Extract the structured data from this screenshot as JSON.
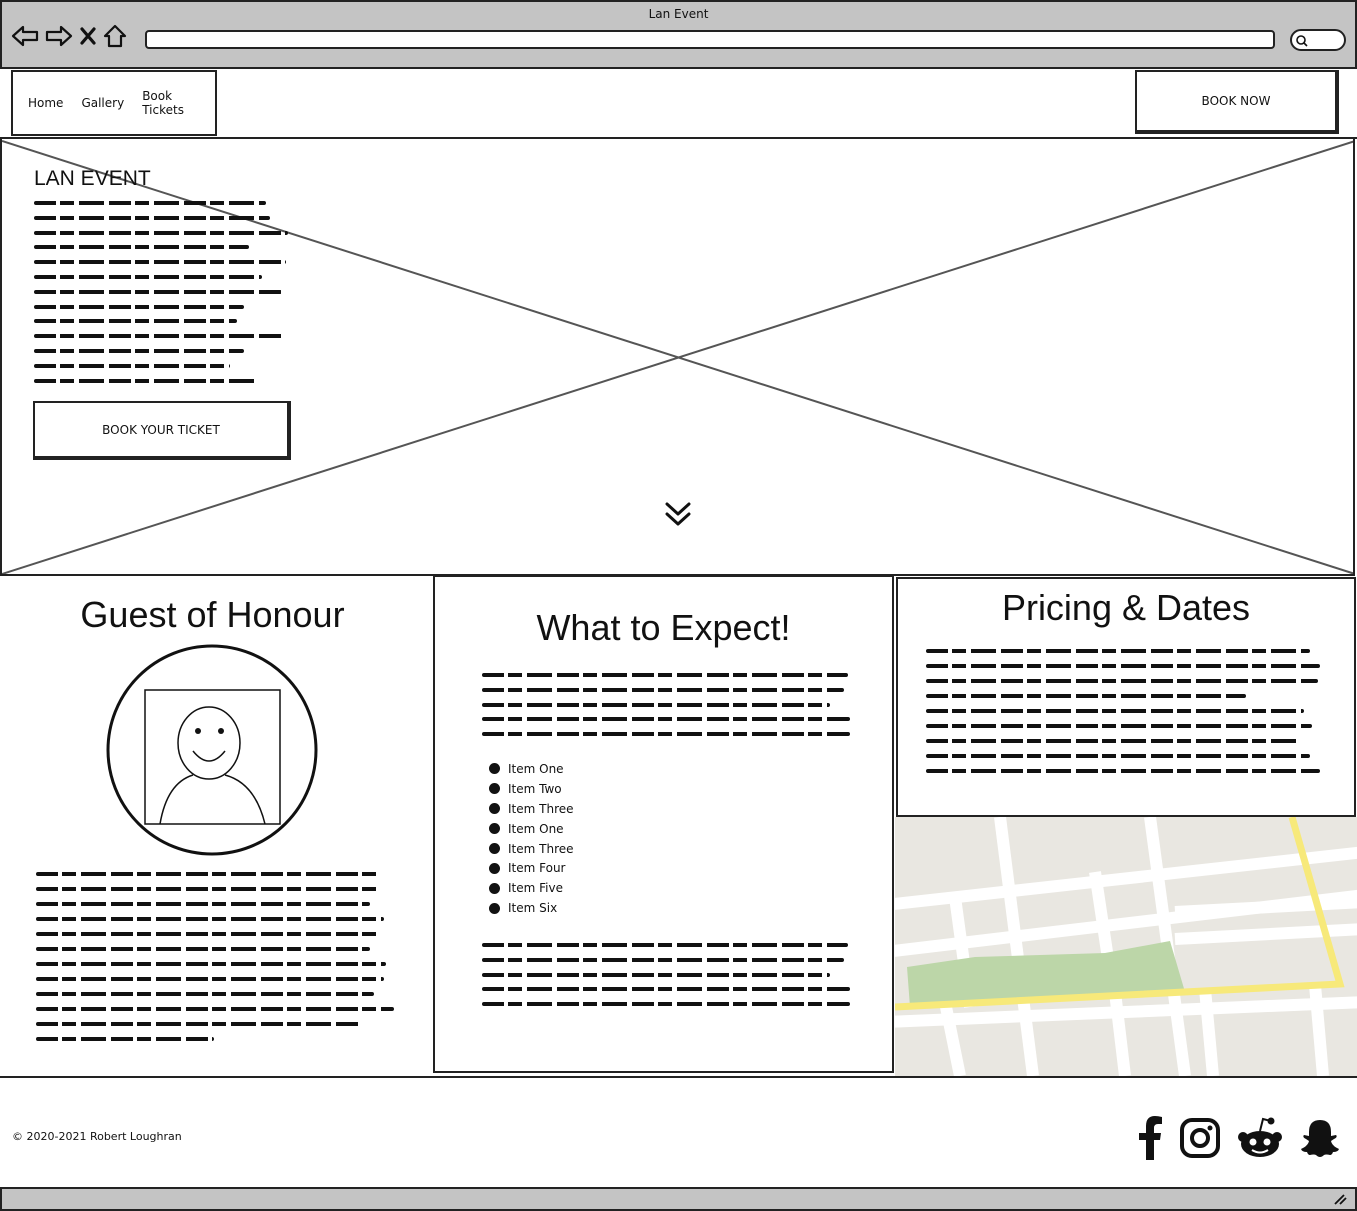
{
  "browser": {
    "title": "Lan Event"
  },
  "nav": {
    "items": [
      "Home",
      "Gallery",
      "Book Tickets"
    ],
    "book_now": "BOOK NOW"
  },
  "hero": {
    "title": "LAN EVENT",
    "button": "BOOK YOUR TICKET"
  },
  "guest": {
    "title": "Guest of Honour"
  },
  "expect": {
    "title": "What to Expect!",
    "items": [
      "Item One",
      "Item Two",
      "Item Three",
      "Item One",
      "Item Three",
      "Item Four",
      "Item Five",
      "Item Six"
    ]
  },
  "pricing": {
    "title": "Pricing & Dates"
  },
  "footer": {
    "copyright": "© 2020-2021 Robert Loughran",
    "socials": [
      "facebook-icon",
      "instagram-icon",
      "reddit-icon",
      "snapchat-icon"
    ]
  },
  "colors": {
    "chrome": "#c4c4c4",
    "map_road_major": "#f7e97a",
    "map_park": "#bcd6a8",
    "map_bg": "#e9e7e1"
  }
}
